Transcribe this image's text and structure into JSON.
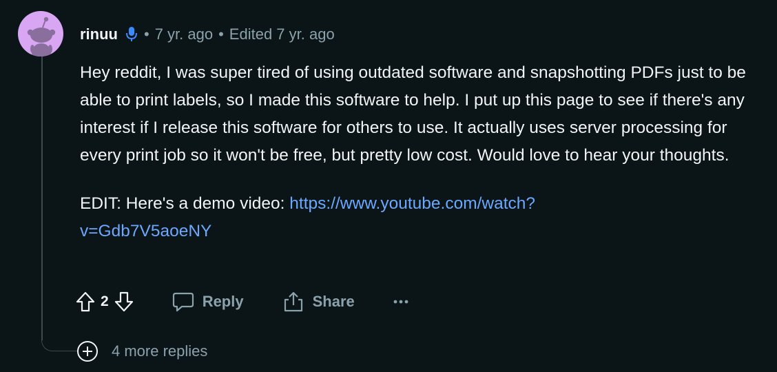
{
  "comment": {
    "author": "rinuu",
    "separator": "•",
    "posted_ago": "7 yr. ago",
    "edited_label": "Edited 7 yr. ago",
    "body_text": "Hey reddit, I was super tired of using outdated software and snapshotting PDFs just to be able to print labels, so I made this software to help. I put up this page to see if there's any interest if I release this software for others to use. It actually uses server processing for every print job so it won't be free, but pretty low cost. Would love to hear your thoughts.",
    "edit_prefix": "EDIT: Here's a demo video: ",
    "edit_link_line1": "https://www.youtube.com/watch?",
    "edit_link_line2": "v=Gdb7V5aoeNY"
  },
  "actions": {
    "score": "2",
    "reply_label": "Reply",
    "share_label": "Share"
  },
  "more_replies_label": "4 more replies",
  "colors": {
    "background": "#0b1416",
    "text": "#f2f4f5",
    "muted": "#8ba2ad",
    "link": "#6ba8ff",
    "avatar_bg": "#d8a6f2",
    "mic_icon": "#3a8bff"
  },
  "icons": {
    "avatar": "reddit-snoo-avatar",
    "mic": "microphone-icon",
    "upvote": "arrow-up-outline-icon",
    "downvote": "arrow-down-outline-icon",
    "reply": "speech-bubble-icon",
    "share": "share-upload-icon",
    "more": "ellipsis-icon",
    "expand": "plus-circle-icon"
  }
}
